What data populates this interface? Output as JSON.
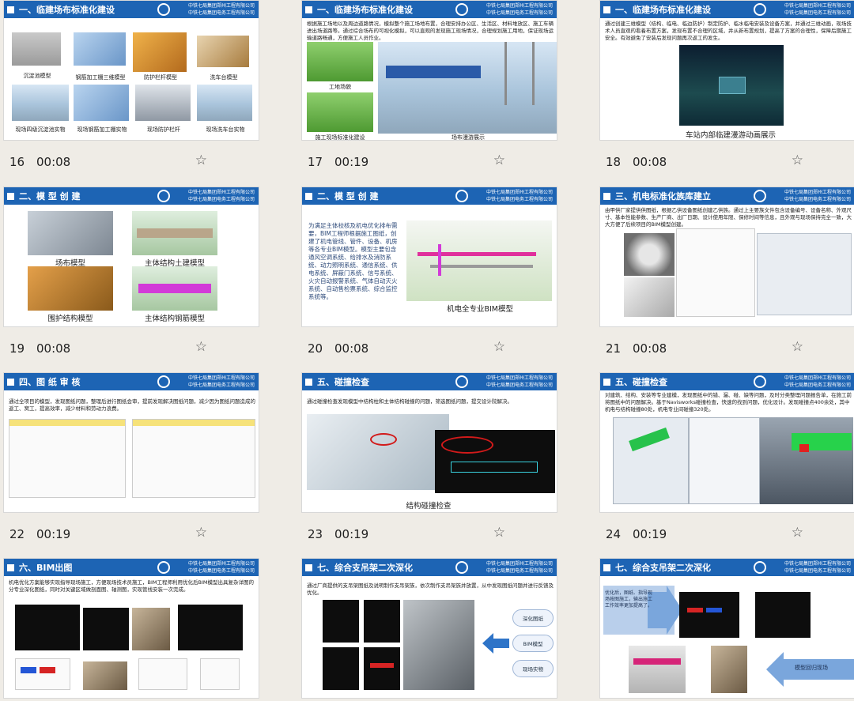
{
  "company_lines": [
    "中铁七局集团郑州工程有限公司",
    "中铁七局集团电务工程有限公司"
  ],
  "slides": [
    {
      "number": "16",
      "duration": "00:08",
      "title": "一、临建场布标准化建设",
      "captions": [
        "沉淀池模型",
        "钢筋加工棚三维模型",
        "防护栏杆模型",
        "洗车台模型",
        "现场四级沉淀池实物",
        "现场钢筋加工棚实物",
        "现场防护栏杆",
        "现场洗车台实物"
      ]
    },
    {
      "number": "17",
      "duration": "00:19",
      "title": "一、临建场布标准化建设",
      "text": "根据施工场地以及周边道路情况，模拟整个施工场地布置，合理安排办公区、生活区、材料堆放区、施工车辆进出场道路等。通过综合场布的可视化模拟，可以直观的发现施工现场情况，合理规划施工用地，保证现场运输道路畅通，方便施工人员作业。",
      "captions": [
        "工地场貌",
        "施工现场标准化建设",
        "场布漫游展示"
      ]
    },
    {
      "number": "18",
      "duration": "00:08",
      "title": "一、临建场布标准化建设",
      "text": "通过创建三维模型（结构、临电、临边防护）制定防护、临水临电安装及设备方案，并通过三维动画，现场技术人员直观的看着布置方案，发现布置不合理的区域，并从新布置规划，提高了方案的合理性，保障后期施工安全。有效避免了安装后发现问题再次返工的发生。",
      "captions": [
        "车站内部临建漫游动画展示"
      ]
    },
    {
      "number": "19",
      "duration": "00:08",
      "title": "二、模 型 创 建",
      "captions": [
        "场布模型",
        "主体结构土建模型",
        "围护结构模型",
        "主体结构钢筋模型"
      ]
    },
    {
      "number": "20",
      "duration": "00:08",
      "title": "二、模 型 创 建",
      "text": "为满足主体校核及机电优化排布需要，BIM工程师根据施工图纸，创建了机电管线、管件、设备、机房等各专业BIM模型。模型主要包含通风空调系统、给排水及消防系统、动力照明系统、通信系统、供电系统、屏蔽门系统、信号系统、火灾自动报警系统、气体自动灭火系统、自动售检票系统、综合监控系统等。",
      "captions": [
        "机电全专业BIM模型"
      ]
    },
    {
      "number": "21",
      "duration": "00:08",
      "title": "三、机电标准化族库建立",
      "text": "由甲供厂家提供供图纸，根据乙供设备图纸创建乙供族。通过上主要族文件包含设备编号、设备名称、外观尺寸、基本性能参数、生产厂商、出厂日期、设计使用年限、保修时间等信息，且外观与现场保持完全一致，大大方便了后续项目的BIM模型创建。"
    },
    {
      "number": "22",
      "duration": "00:19",
      "title": "四、图 纸 审 核",
      "text": "通过全项目的模型，发现图纸问题，整理后进行图纸会审，提前发现解决图纸问题，减少因为图纸问题造成的返工、窝工，提高效率，减少材料和劳动力浪费。"
    },
    {
      "number": "23",
      "duration": "00:19",
      "title": "五、碰撞检查",
      "text": "通过碰撞检查发现模型中结构柱和主体结构碰撞的问题，筛选图纸问题，提交设计院解决。",
      "captions": [
        "结构碰撞检查"
      ]
    },
    {
      "number": "24",
      "duration": "00:19",
      "title": "五、碰撞检查",
      "text": "对建筑、结构、安装等专业建模，发现图纸中的错、漏、碰、缺等问题，及时分类整理问题报告单，在施工前将图纸中的问题解决。基于Navisworks碰撞检查，快速的找到问题，优化设计。发现碰撞点400余处，其中机电与结构碰撞80处，机电专业间碰撞320处。"
    },
    {
      "title": "六、BIM出图",
      "text": "机电优化方案能够实现指导现场施工，方便现场技术员施工，BIM工程师利用优化后BIM模型出具复杂详图的分专业深化图纸，同时对关键区域做剖面图、轴测图，实现管线安装一次完成。"
    },
    {
      "title": "七、综合支吊架二次深化",
      "text": "通过厂商提供的支吊架图纸及说明制作支吊架族，依次制作支吊架族并放置，从中发现图纸问题并进行反馈及优化。",
      "labels": [
        "深化图纸",
        "BIM模型",
        "现场实物"
      ]
    },
    {
      "title": "七、综合支吊架二次深化",
      "labels": [
        "优化后，图纸、指导现场按图施工，输出施工工作效率更加提高了。",
        "模型回归现场"
      ]
    }
  ]
}
